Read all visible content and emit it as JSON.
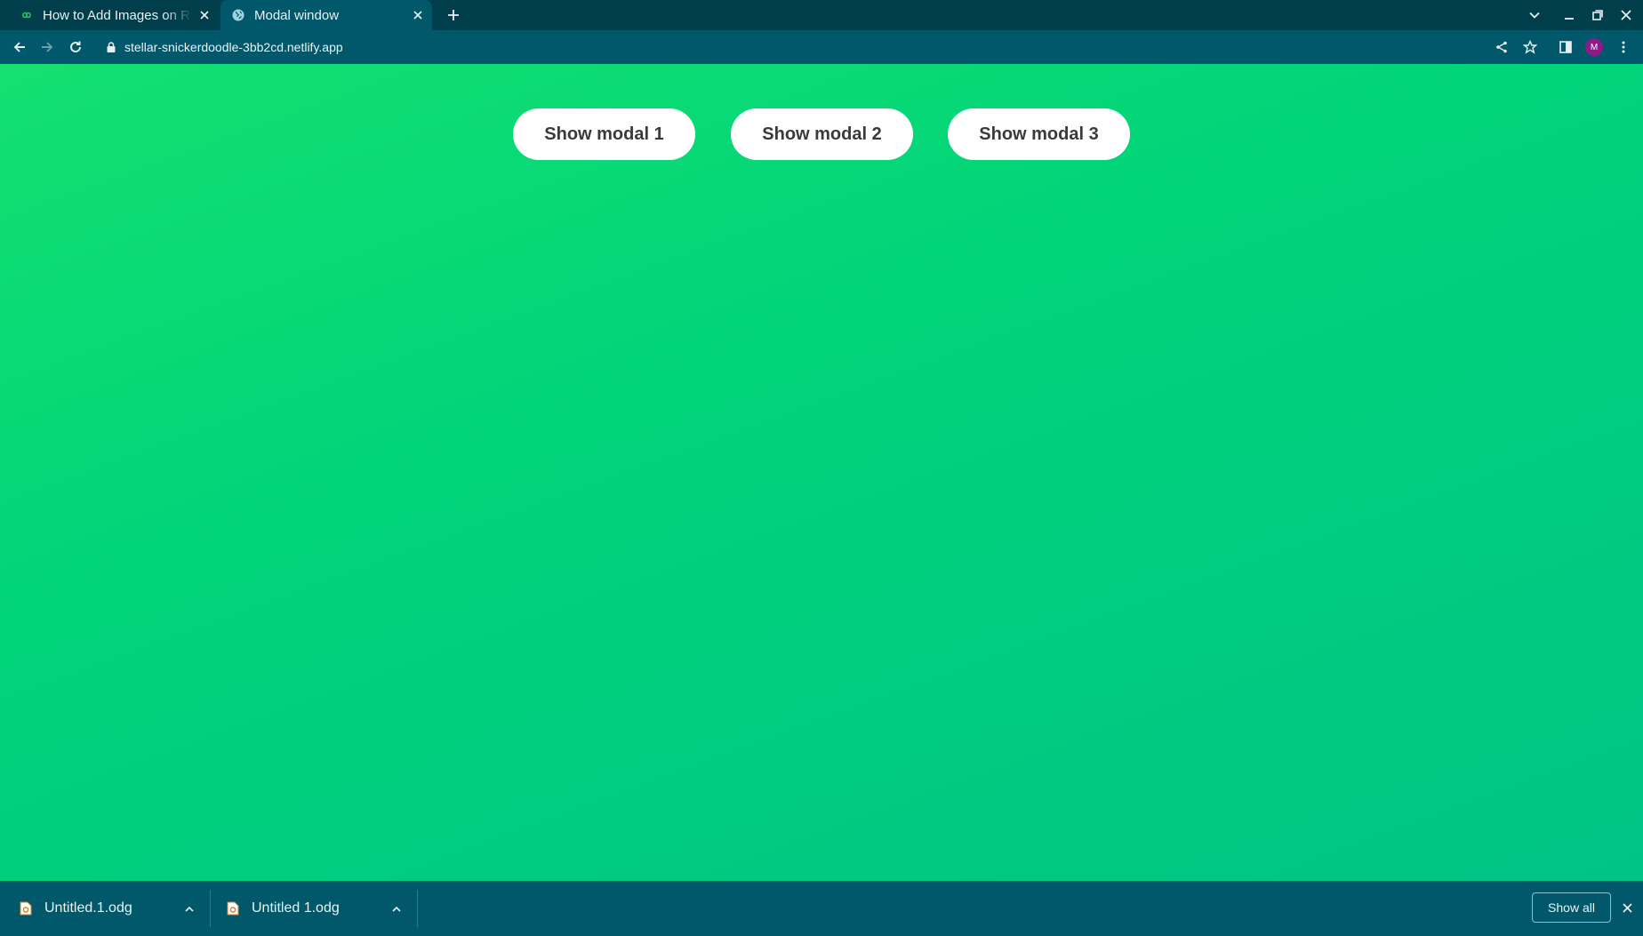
{
  "browser": {
    "tabs": [
      {
        "title": "How to Add Images on RE",
        "active": false,
        "favicon": "infinity-favicon-icon"
      },
      {
        "title": "Modal window",
        "active": true,
        "favicon": "globe-icon"
      }
    ],
    "url": "stellar-snickerdoodle-3bb2cd.netlify.app",
    "avatar_initial": "M"
  },
  "page": {
    "buttons": [
      {
        "label": "Show modal 1"
      },
      {
        "label": "Show modal 2"
      },
      {
        "label": "Show modal 3"
      }
    ],
    "gradient_colors": [
      "#14e070",
      "#00c485"
    ]
  },
  "downloads": {
    "items": [
      {
        "name": "Untitled.1.odg"
      },
      {
        "name": "Untitled 1.odg"
      }
    ],
    "show_all_label": "Show all"
  },
  "colors": {
    "tabstrip_bg": "#003e4c",
    "toolbar_bg": "#01586a",
    "button_text": "#3a3a3a"
  }
}
